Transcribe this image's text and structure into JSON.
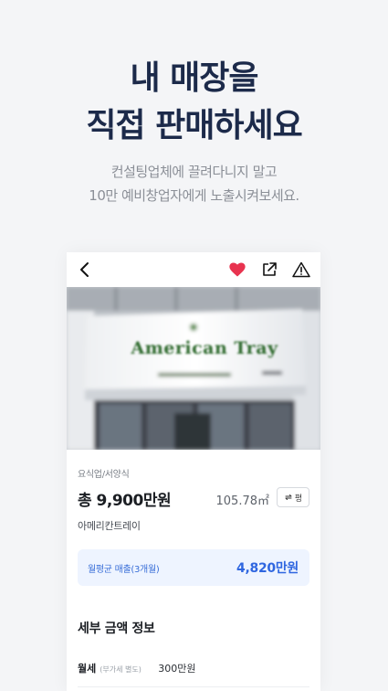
{
  "headline": {
    "line1": "내 매장을",
    "line2": "직접 판매하세요"
  },
  "subline": {
    "line1": "컨설팅업체에 끌려다니지 말고",
    "line2": "10만 예비창업자에게 노출시켜보세요."
  },
  "listing": {
    "photo_sign_text": "American Tray",
    "category": "요식업/서양식",
    "price": "총 9,900만원",
    "area": "105.78㎡",
    "unit_toggle_label": "평",
    "store_name": "아메리칸트레이",
    "sales_label": "월평균 매출(3개월)",
    "sales_value": "4,820만원",
    "section_title": "세부 금액 정보",
    "details": [
      {
        "label": "월세",
        "note": "(부가세 별도)",
        "value": "300만원"
      }
    ]
  },
  "colors": {
    "heart": "#e8334f",
    "accent": "#2f66e0",
    "headline": "#1c2a4a"
  }
}
